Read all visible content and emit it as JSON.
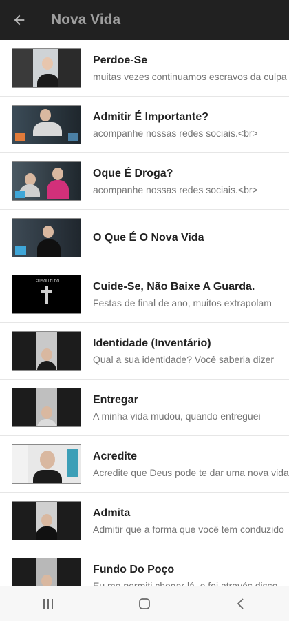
{
  "appbar": {
    "title": "Nova Vida",
    "back_icon": "arrow-left-icon"
  },
  "items": [
    {
      "title": "Perdoe-Se",
      "subtitle": "muitas vezes continuamos escravos da culpa"
    },
    {
      "title": "Admitir É Importante?",
      "subtitle": "acompanhe nossas redes sociais.<br>"
    },
    {
      "title": "Oque É Droga?",
      "subtitle": "acompanhe nossas redes sociais.<br>"
    },
    {
      "title": "O Que É O Nova Vida",
      "subtitle": ""
    },
    {
      "title": "Cuide-Se, Não Baixe A Guarda.",
      "subtitle": "Festas de final de ano, muitos extrapolam"
    },
    {
      "title": "Identidade (Inventário)",
      "subtitle": "Qual a sua identidade? Você saberia dizer"
    },
    {
      "title": "Entregar",
      "subtitle": "A minha vida mudou, quando entreguei"
    },
    {
      "title": "Acredite",
      "subtitle": "Acredite que Deus pode te dar uma nova vida"
    },
    {
      "title": "Admita",
      "subtitle": "Admitir que a forma que você tem conduzido"
    },
    {
      "title": "Fundo Do Poço",
      "subtitle": "Eu me permiti chegar lá, e foi através disso"
    }
  ],
  "thumb_text": {
    "item5": "EU SOU TUDO"
  },
  "navbar": {
    "recent": "recent-apps-icon",
    "home": "home-icon",
    "back": "back-icon"
  },
  "colors": {
    "appbar": "#212121",
    "appbar_title": "#9e9e9e",
    "title": "#222222",
    "subtitle": "#757575"
  }
}
